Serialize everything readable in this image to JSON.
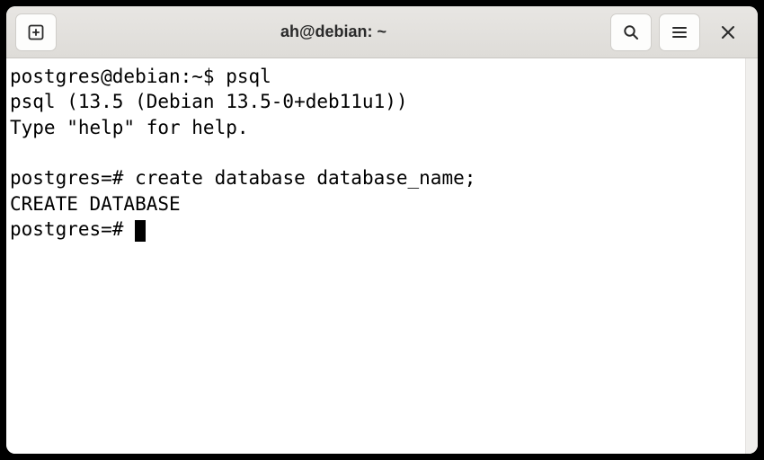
{
  "window": {
    "title": "ah@debian: ~"
  },
  "terminal": {
    "lines": [
      {
        "prompt": "postgres@debian:~$ ",
        "cmd": "psql"
      },
      {
        "text": "psql (13.5 (Debian 13.5-0+deb11u1))"
      },
      {
        "text": "Type \"help\" for help."
      },
      {
        "text": ""
      },
      {
        "prompt": "postgres=# ",
        "cmd": "create database database_name;"
      },
      {
        "text": "CREATE DATABASE"
      },
      {
        "prompt": "postgres=# ",
        "cursor": true
      }
    ]
  }
}
